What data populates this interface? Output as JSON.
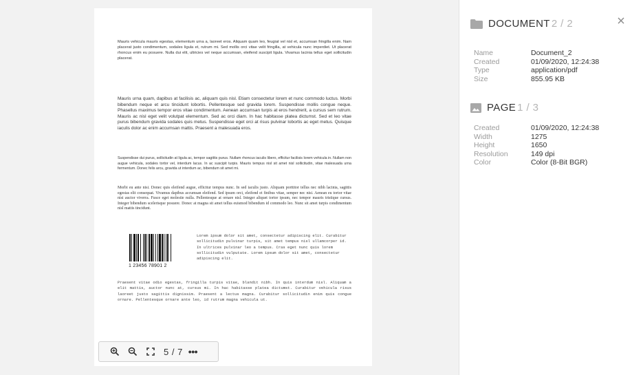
{
  "document": {
    "paragraphs": [
      "Mauris vehicula mauris egestas, elementum urna a, laoreet eros. Aliquam quam leo, feugiat vel nisl et, accumsan fringilla enim. Nam placerat justo condimentum, sodales ligula et, rutrum mi. Sed mollis orci vitae velit fringilla, at vehicula nunc imperdiet. Ut placerat rhoncus enim eu posuere. Nulla dui elit, ultricies vel neque accumsan, eleifend suscipit ligula. Vivamus lacinia tellus eget sollicitudin placerat.",
      "Mauris urna quam, dapibus at facilisis ac, aliquam quis nisl. Etiam consectetur lorem et nunc commodo luctus. Morbi bibendum neque et arcu tincidunt lobortis. Pellentesque sed gravida lorem. Suspendisse mollis congue neque. Phasellus maximus tempor eros vitae condimentum. Aenean accumsan turpis at eros hendrerit, a cursus sem rutrum. Mauris ac nisl eget velit volutpat elementum. Sed ac orci diam. In hac habitasse platea dictumst. Sed et leo vitae purus bibendum gravida sodales quis metus. Suspendisse eget orci at risus pulvinar lobortis ac eget metus. Quisque iaculis dolor ac enim accumsan mattis. Praesent a malesuada eros.",
      "Suspendisse dui purus, sollicitudin at ligula ac, tempor sagittis purus. Nullam rhoncus iaculis libero, efficitur facilisis lorem vehicula in. Nullam non augue vehicula, sodales tortor vel, interdum lacus. In ac suscipit turpis. Mauris tempus nisl sit amet nisl sollicitudin, vitae malesuada urna fermentum. Donec felis arcu, gravida ut interdum ac, bibendum sit amet mi.",
      "Morbi eu ante nisi. Donec quis eleifend augue, efficitur tempus nunc. In sed iaculis justo. Aliquam porttitor tellus nec nibh lacinia, sagittis egestas elit consequat. Vivamus dapibus accumsan eleifend. Sed ipsum orci, eleifend et finibus vitae, semper nec nisi. Aenean eu tortor vitae nisi auctor viverra. Fusce eget molestie nulla. Pellentesque at ornare nisl. Integer aliquet tortor ipsum, nec tempor mauris tristique cursus. Integer bibendum scelerisque posuere. Donec at magna sit amet tellus euismod bibendum id commodo leo. Nunc sit amet turpis condimentum nisl mattis tincidunt.",
      "Lorem ipsum dolor sit amet, consectetur adipiscing elit. Curabitur sollicitudin pulvinar turpis, sit amet tempus nisl ullamcorper id. In ultrices pulvinar leo a tempus. Cras eget nunc quis lorem sollicitudin vulputate. Lorem ipsum dolor sit amet, consectetur adipiscing elit.",
      "Praesent vitae odio egestas, fringilla turpis vitae, blandit nibh. In quis interdum nisl. Aliquam a elit mattis, auctor nunc at, cursus mi. In hac habitasse platea dictumst. Curabitur vehicula risus laoreet justo sagittis dignissim. Praesent a lectus magna. Curabitur sollicitudin enim quis congue ornare. Pellentesque ornare ante leo, id rutrum magna vehicula ut."
    ],
    "barcode_text": "1 23456 78901 2"
  },
  "toolbar": {
    "zoom_in_icon": "zoom-in-icon",
    "zoom_out_icon": "zoom-out-icon",
    "fullscreen_icon": "fullscreen-icon",
    "page_indicator": "5 / 7",
    "more_label": "•••"
  },
  "panel": {
    "document_section": {
      "title": "DOCUMENT",
      "count": "2 / 2",
      "icon": "folder-icon",
      "rows": [
        {
          "key": "Name",
          "value": "Document_2"
        },
        {
          "key": "Created",
          "value": "01/09/2020, 12:24:38"
        },
        {
          "key": "Type",
          "value": "application/pdf"
        },
        {
          "key": "Size",
          "value": "855.95 KB"
        }
      ]
    },
    "page_section": {
      "title": "PAGE",
      "count": "1 / 3",
      "icon": "image-icon",
      "rows": [
        {
          "key": "Created",
          "value": "01/09/2020, 12:24:38"
        },
        {
          "key": "Width",
          "value": "1275"
        },
        {
          "key": "Height",
          "value": "1650"
        },
        {
          "key": "Resolution",
          "value": "149 dpi"
        },
        {
          "key": "Color",
          "value": "Color (8-Bit BGR)"
        }
      ]
    },
    "close_icon": "close-icon"
  },
  "colors": {
    "background": "#f2f2f2",
    "panel": "#ffffff",
    "label": "#9a9a9a",
    "muted_count": "#b5b5b5",
    "icon": "#a8a8a8"
  }
}
